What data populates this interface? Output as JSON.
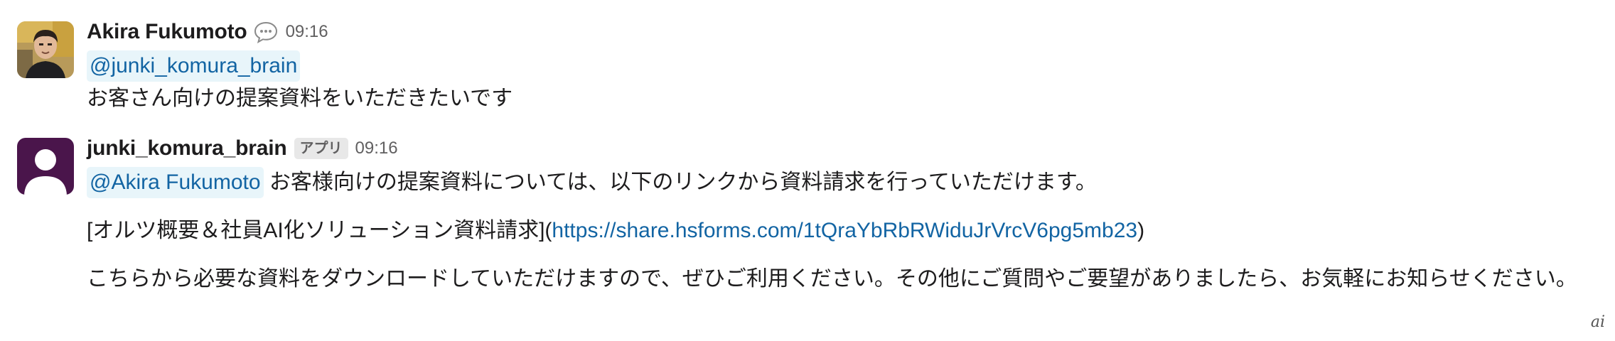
{
  "messages": [
    {
      "sender": "Akira Fukumoto",
      "status_icon": "speech-bubble-icon",
      "time": "09:16",
      "mention": "@junki_komura_brain",
      "text": "お客さん向けの提案資料をいただきたいです"
    },
    {
      "sender": "junki_komura_brain",
      "badge": "アプリ",
      "time": "09:16",
      "mention": "@Akira Fukumoto",
      "text": "お客様向けの提案資料については、以下のリンクから資料請求を行っていただけます。",
      "link_prefix": "[オルツ概要＆社員AI化ソリューション資料請求](",
      "link_url": "https://share.hsforms.com/1tQraYbRbRWiduJrVrcV6pg5mb23",
      "link_suffix": ")",
      "closing_text": "こちらから必要な資料をダウンロードしていただけますので、ぜひご利用ください。その他にご質問やご要望がありましたら、お気軽にお知らせください。"
    }
  ],
  "watermark": "ai"
}
